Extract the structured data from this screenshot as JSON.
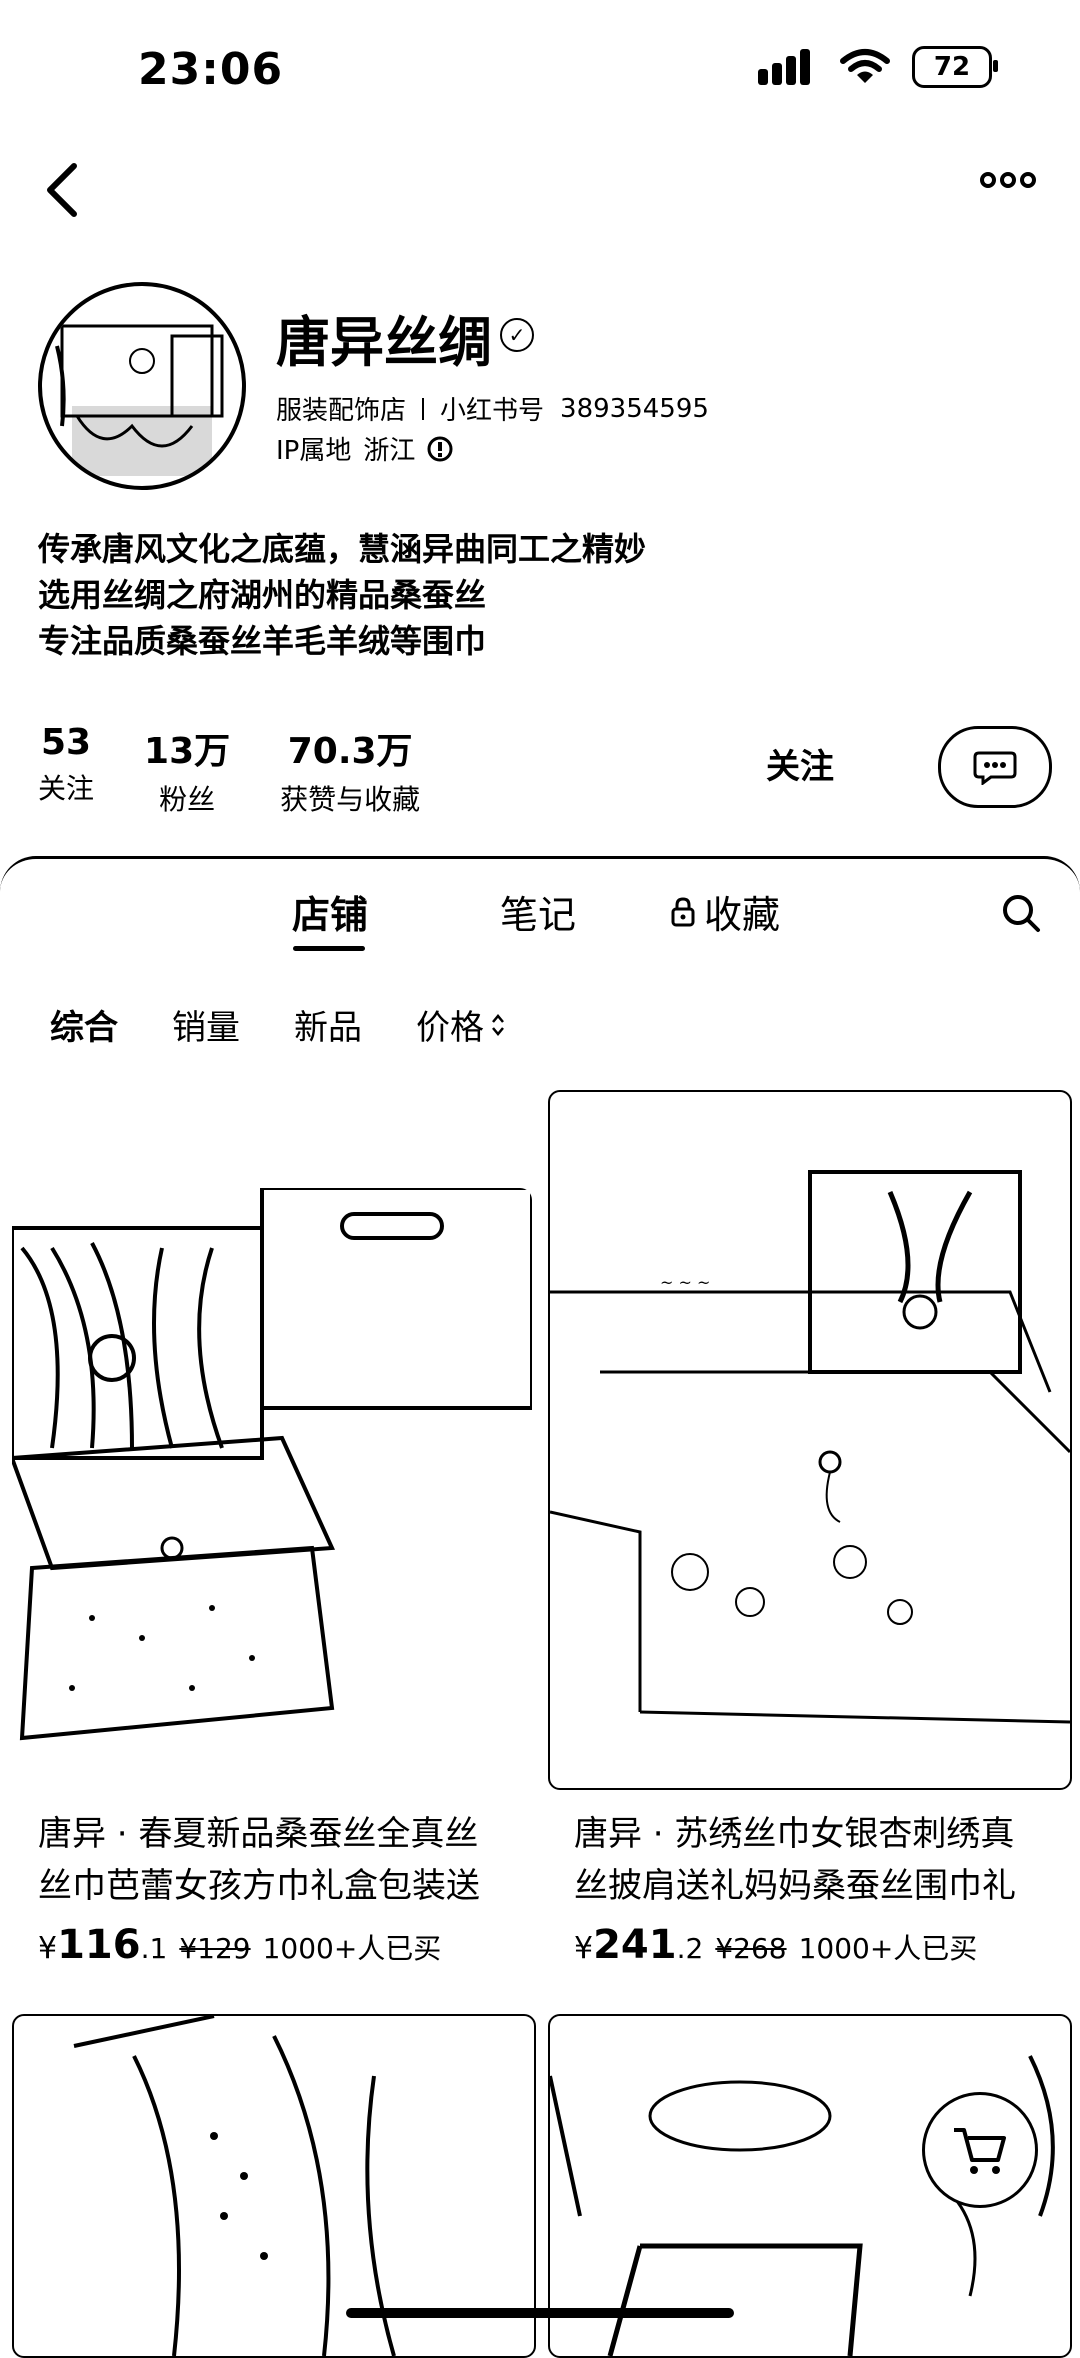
{
  "status_bar": {
    "time": "23:06",
    "battery": "72"
  },
  "profile": {
    "name": "唐异丝绸",
    "category": "服装配饰店",
    "xhs_label": "小红书号",
    "xhs_id": "389354595",
    "ip_label": "IP属地",
    "ip_value": "浙江",
    "bio": [
      "传承唐风文化之底蕴，慧涵异曲同工之精妙",
      "选用丝绸之府湖州的精品桑蚕丝",
      "专注品质桑蚕丝羊毛羊绒等围巾"
    ]
  },
  "stats": [
    {
      "num": "53",
      "label": "关注"
    },
    {
      "num": "13万",
      "label": "粉丝"
    },
    {
      "num": "70.3万",
      "label": "获赞与收藏"
    }
  ],
  "actions": {
    "follow": "关注"
  },
  "tabs": [
    "店铺",
    "笔记",
    "收藏"
  ],
  "filters": [
    "综合",
    "销量",
    "新品",
    "价格"
  ],
  "products": [
    {
      "title_line1": "唐异 · 春夏新品桑蚕丝全真丝",
      "title_line2": "丝巾芭蕾女孩方巾礼盒包装送",
      "currency": "¥",
      "price_int": "116",
      "price_dec": ".1",
      "orig_price": "¥129",
      "sold": "1000+人已买"
    },
    {
      "title_line1": "唐异 · 苏绣丝巾女银杏刺绣真",
      "title_line2": "丝披肩送礼妈妈桑蚕丝围巾礼",
      "currency": "¥",
      "price_int": "241",
      "price_dec": ".2",
      "orig_price": "¥268",
      "sold": "1000+人已买"
    }
  ],
  "icons": [
    "back-arrow-icon",
    "more-dots-icon",
    "verified-icon",
    "info-icon",
    "chat-icon",
    "lock-icon",
    "search-icon",
    "sort-icon",
    "cart-icon"
  ]
}
